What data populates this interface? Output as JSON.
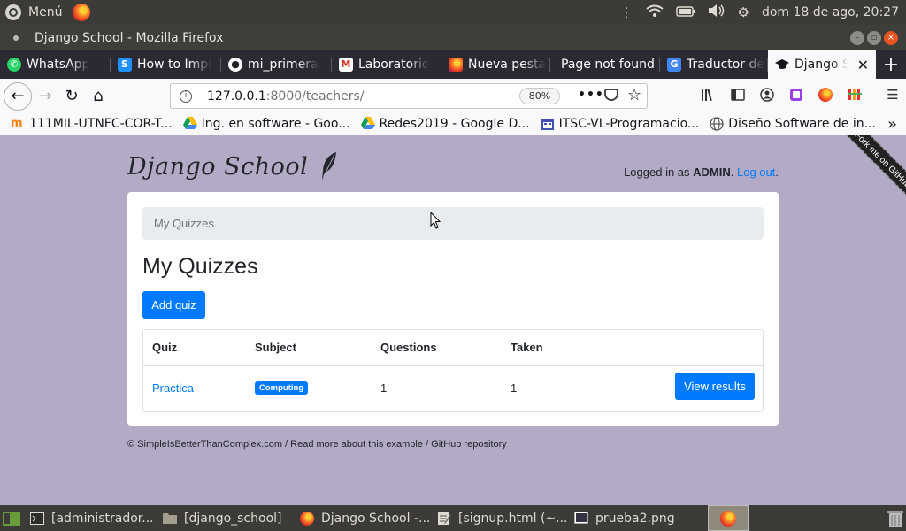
{
  "top_panel": {
    "menu_label": "Menú",
    "datetime": "dom 18 de ago, 20:27"
  },
  "window": {
    "title": "Django School - Mozilla Firefox"
  },
  "tabs": [
    {
      "label": "WhatsApp",
      "favicon": "whatsapp-icon",
      "color": "#25d366"
    },
    {
      "label": "How to Impl",
      "favicon": "stackoverflow-icon",
      "color": "#1e90ff"
    },
    {
      "label": "mi_primera",
      "favicon": "github-icon",
      "color": "#ffffff"
    },
    {
      "label": "Laboratorio",
      "favicon": "gmail-icon",
      "color": "#d93025"
    },
    {
      "label": "Nueva pesta",
      "favicon": "firefox-icon",
      "color": "#ff7b2a"
    },
    {
      "label": "Page not found",
      "favicon": "none",
      "color": ""
    },
    {
      "label": "Traductor de",
      "favicon": "translate-icon",
      "color": "#4285f4"
    },
    {
      "label": "Django Sc",
      "favicon": "school-icon",
      "color": "#15141a",
      "active": true
    }
  ],
  "address_bar": {
    "url_host": "127.0.0.1",
    "url_rest": ":8000/teachers/",
    "zoom": "80%"
  },
  "bookmarks": [
    {
      "label": "111MIL-UTNFC-COR-T...",
      "icon": "moodle-icon"
    },
    {
      "label": "Ing. en software - Goo...",
      "icon": "google-drive-icon"
    },
    {
      "label": "Redes2019 - Google D...",
      "icon": "google-drive-icon"
    },
    {
      "label": "ITSC-VL-Programacio...",
      "icon": "calendar-icon"
    },
    {
      "label": "Diseño Software de in...",
      "icon": "globe-icon"
    }
  ],
  "site": {
    "brand": "Django School",
    "login_prefix": "Logged in as ",
    "login_user": "ADMIN",
    "login_sep": ". ",
    "logout_label": "Log out",
    "login_suffix": ".",
    "ribbon": "Fork me on GitHub"
  },
  "main": {
    "breadcrumb": "My Quizzes",
    "title": "My Quizzes",
    "add_quiz_label": "Add quiz",
    "table": {
      "headers": [
        "Quiz",
        "Subject",
        "Questions",
        "Taken"
      ],
      "rows": [
        {
          "quiz": "Practica",
          "subject": "Computing",
          "questions": "1",
          "taken": "1",
          "action": "View results"
        }
      ]
    }
  },
  "footer": "© SimpleIsBetterThanComplex.com / Read more about this example / GitHub repository",
  "taskbar": [
    {
      "label": "[administrador...",
      "icon": "terminal-icon"
    },
    {
      "label": "[django_school]",
      "icon": "folder-icon"
    },
    {
      "label": "Django School -...",
      "icon": "firefox-icon"
    },
    {
      "label": "[signup.html (~...",
      "icon": "text-editor-icon"
    },
    {
      "label": "prueba2.png",
      "icon": "image-icon"
    }
  ],
  "colors": {
    "page_bg": "#b3aac6",
    "primary": "#007bff",
    "ubuntu_accent": "#e95420"
  }
}
